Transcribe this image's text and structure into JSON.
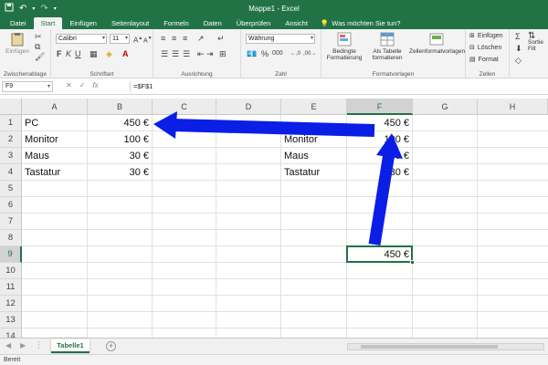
{
  "window": {
    "title": "Mappe1 - Excel"
  },
  "ribbon_tabs": [
    "Datei",
    "Start",
    "Einfügen",
    "Seitenlayout",
    "Formeln",
    "Daten",
    "Überprüfen",
    "Ansicht"
  ],
  "active_tab": "Start",
  "tell_me": "Was möchten Sie tun?",
  "ribbon": {
    "paste_label": "Einfügen",
    "font_name": "Calibri",
    "font_size": "11",
    "number_format": "Währung",
    "cond_format_label": "Bedingte Formatierung",
    "as_table_label": "Als Tabelle formatieren",
    "cell_styles_label": "Zellenformatvorlagen",
    "insert_label": "Einfügen",
    "delete_label": "Löschen",
    "format_label": "Format",
    "sort_label": "Sortie Filt",
    "groups": {
      "clipboard": "Zwischenablage",
      "font": "Schriftart",
      "alignment": "Ausrichtung",
      "number": "Zahl",
      "styles": "Formatvorlagen",
      "cells": "Zellen"
    }
  },
  "formula_bar": {
    "name_box": "F9",
    "formula": "=$F$1"
  },
  "columns": [
    "A",
    "B",
    "C",
    "D",
    "E",
    "F",
    "G",
    "H"
  ],
  "rows": [
    "1",
    "2",
    "3",
    "4",
    "5",
    "6",
    "7",
    "8",
    "9",
    "10",
    "11",
    "12",
    "13",
    "14"
  ],
  "cells": {
    "A1": "PC",
    "A2": "Monitor",
    "A3": "Maus",
    "A4": "Tastatur",
    "B1": "450 €",
    "B2": "100 €",
    "B3": "30 €",
    "B4": "30 €",
    "E2": "Monitor",
    "E3": "Maus",
    "E4": "Tastatur",
    "F1": "450 €",
    "F2": "100 €",
    "F3": "30 €",
    "F4": "30 €",
    "F9": "450 €"
  },
  "sheet_tabs": [
    "Tabelle1"
  ],
  "status": "Bereit",
  "colors": {
    "excel_green": "#217346",
    "arrow_blue": "#0a1ee6"
  }
}
